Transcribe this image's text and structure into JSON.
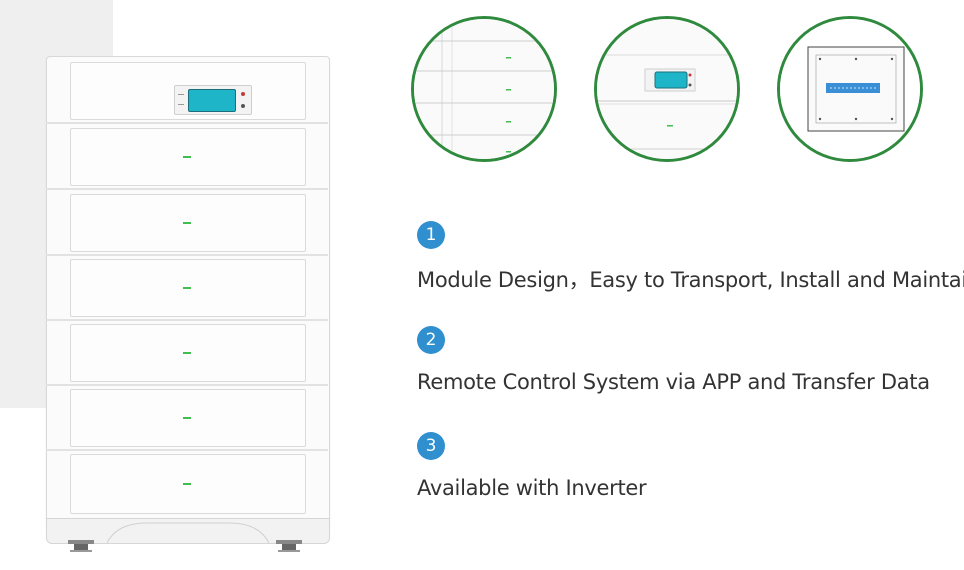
{
  "features": [
    {
      "number": "1",
      "text": "Module Design，Easy to Transport, Install and Maintain"
    },
    {
      "number": "2",
      "text": "Remote Control System via APP and Transfer Data"
    },
    {
      "number": "3",
      "text": "Available with Inverter"
    }
  ],
  "colors": {
    "badge": "#2f8fcf",
    "circle_border": "#2f8a3e",
    "lcd_screen": "#1fb5c8",
    "status_led": "#3fbf4f"
  }
}
